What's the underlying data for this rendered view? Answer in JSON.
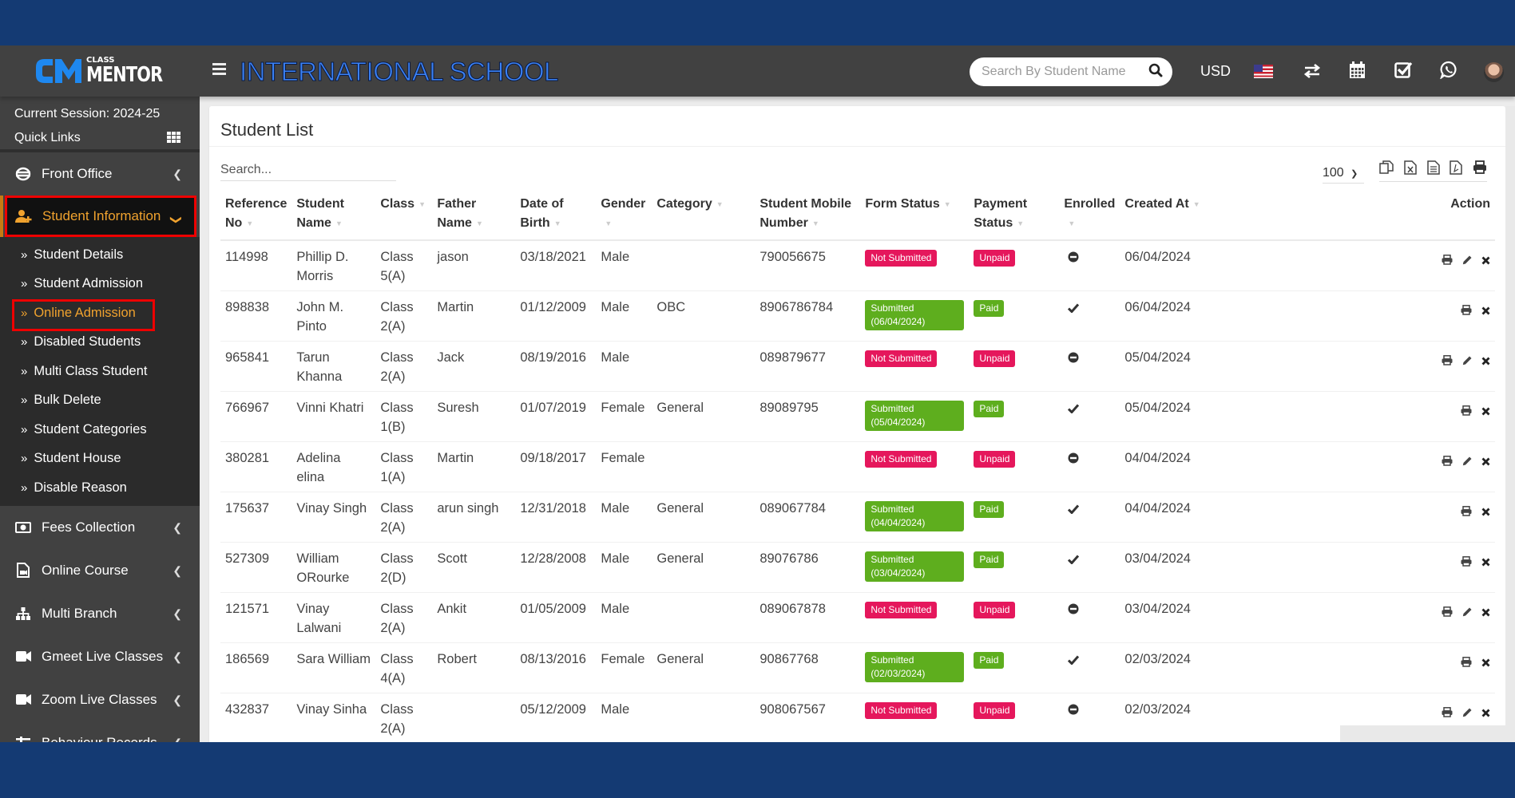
{
  "header": {
    "logo_small": "CLASS",
    "logo_big": "MENTOR",
    "school_name": "INTERNATIONAL SCHOOL",
    "search_placeholder": "Search By Student Name",
    "currency": "USD",
    "icons": [
      "us-flag-icon",
      "switch-arrows-icon",
      "calendar-icon",
      "checkbox-icon",
      "whatsapp-icon",
      "user-avatar"
    ]
  },
  "sidebar": {
    "session": "Current Session: 2024-25",
    "quick_links": "Quick Links",
    "items": [
      {
        "label": "Front Office",
        "icon": "front-office-icon",
        "active": false
      },
      {
        "label": "Student Information",
        "icon": "user-plus-icon",
        "active": true
      },
      {
        "label": "Fees Collection",
        "icon": "money-icon",
        "active": false
      },
      {
        "label": "Online Course",
        "icon": "file-video-icon",
        "active": false
      },
      {
        "label": "Multi Branch",
        "icon": "sitemap-icon",
        "active": false
      },
      {
        "label": "Gmeet Live Classes",
        "icon": "video-camera-icon",
        "active": false
      },
      {
        "label": "Zoom Live Classes",
        "icon": "video-camera-icon",
        "active": false
      },
      {
        "label": "Behaviour Records",
        "icon": "sliders-icon",
        "active": false
      }
    ],
    "submenu": [
      {
        "label": "Student Details",
        "active": false
      },
      {
        "label": "Student Admission",
        "active": false
      },
      {
        "label": "Online Admission",
        "active": true
      },
      {
        "label": "Disabled Students",
        "active": false
      },
      {
        "label": "Multi Class Student",
        "active": false
      },
      {
        "label": "Bulk Delete",
        "active": false
      },
      {
        "label": "Student Categories",
        "active": false
      },
      {
        "label": "Student House",
        "active": false
      },
      {
        "label": "Disable Reason",
        "active": false
      }
    ]
  },
  "main": {
    "title": "Student List",
    "search_placeholder": "Search...",
    "page_length": "100",
    "export_buttons": [
      "copy-icon",
      "excel-icon",
      "csv-icon",
      "pdf-icon",
      "print-icon"
    ],
    "columns": [
      {
        "label": "Reference No",
        "sortable": true
      },
      {
        "label": "Student Name",
        "sortable": true
      },
      {
        "label": "Class",
        "sortable": true
      },
      {
        "label": "Father Name",
        "sortable": true
      },
      {
        "label": "Date of Birth",
        "sortable": true
      },
      {
        "label": "Gender",
        "sortable": true
      },
      {
        "label": "Category",
        "sortable": true
      },
      {
        "label": "Student Mobile Number",
        "sortable": true
      },
      {
        "label": "Form Status",
        "sortable": true
      },
      {
        "label": "Payment Status",
        "sortable": true
      },
      {
        "label": "Enrolled",
        "sortable": true
      },
      {
        "label": "Created At",
        "sortable": true
      },
      {
        "label": "Action",
        "sortable": false
      }
    ],
    "rows": [
      {
        "ref": "114998",
        "name": "Phillip D. Morris",
        "class": "Class 5(A)",
        "father": "jason",
        "dob": "03/18/2021",
        "gender": "Male",
        "category": "",
        "mobile": "790056675",
        "form_status": "Not Submitted",
        "form_ok": false,
        "payment": "Unpaid",
        "paid": false,
        "enrolled": false,
        "created": "06/04/2024"
      },
      {
        "ref": "898838",
        "name": "John M. Pinto",
        "class": "Class 2(A)",
        "father": "Martin",
        "dob": "01/12/2009",
        "gender": "Male",
        "category": "OBC",
        "mobile": "8906786784",
        "form_status": "Submitted (06/04/2024)",
        "form_ok": true,
        "payment": "Paid",
        "paid": true,
        "enrolled": true,
        "created": "06/04/2024"
      },
      {
        "ref": "965841",
        "name": "Tarun Khanna",
        "class": "Class 2(A)",
        "father": "Jack",
        "dob": "08/19/2016",
        "gender": "Male",
        "category": "",
        "mobile": "089879677",
        "form_status": "Not Submitted",
        "form_ok": false,
        "payment": "Unpaid",
        "paid": false,
        "enrolled": false,
        "created": "05/04/2024"
      },
      {
        "ref": "766967",
        "name": "Vinni Khatri",
        "class": "Class 1(B)",
        "father": "Suresh",
        "dob": "01/07/2019",
        "gender": "Female",
        "category": "General",
        "mobile": "89089795",
        "form_status": "Submitted (05/04/2024)",
        "form_ok": true,
        "payment": "Paid",
        "paid": true,
        "enrolled": true,
        "created": "05/04/2024"
      },
      {
        "ref": "380281",
        "name": "Adelina elina",
        "class": "Class 1(A)",
        "father": "Martin",
        "dob": "09/18/2017",
        "gender": "Female",
        "category": "",
        "mobile": "",
        "form_status": "Not Submitted",
        "form_ok": false,
        "payment": "Unpaid",
        "paid": false,
        "enrolled": false,
        "created": "04/04/2024"
      },
      {
        "ref": "175637",
        "name": "Vinay Singh",
        "class": "Class 2(A)",
        "father": "arun singh",
        "dob": "12/31/2018",
        "gender": "Male",
        "category": "General",
        "mobile": "089067784",
        "form_status": "Submitted (04/04/2024)",
        "form_ok": true,
        "payment": "Paid",
        "paid": true,
        "enrolled": true,
        "created": "04/04/2024"
      },
      {
        "ref": "527309",
        "name": "William ORourke",
        "class": "Class 2(D)",
        "father": "Scott",
        "dob": "12/28/2008",
        "gender": "Male",
        "category": "General",
        "mobile": "89076786",
        "form_status": "Submitted (03/04/2024)",
        "form_ok": true,
        "payment": "Paid",
        "paid": true,
        "enrolled": true,
        "created": "03/04/2024"
      },
      {
        "ref": "121571",
        "name": "Vinay Lalwani",
        "class": "Class 2(A)",
        "father": "Ankit",
        "dob": "01/05/2009",
        "gender": "Male",
        "category": "",
        "mobile": "089067878",
        "form_status": "Not Submitted",
        "form_ok": false,
        "payment": "Unpaid",
        "paid": false,
        "enrolled": false,
        "created": "03/04/2024"
      },
      {
        "ref": "186569",
        "name": "Sara William",
        "class": "Class 4(A)",
        "father": "Robert",
        "dob": "08/13/2016",
        "gender": "Female",
        "category": "General",
        "mobile": "90867768",
        "form_status": "Submitted (02/03/2024)",
        "form_ok": true,
        "payment": "Paid",
        "paid": true,
        "enrolled": true,
        "created": "02/03/2024"
      },
      {
        "ref": "432837",
        "name": "Vinay Sinha",
        "class": "Class 2(A)",
        "father": "",
        "dob": "05/12/2009",
        "gender": "Male",
        "category": "",
        "mobile": "908067567",
        "form_status": "Not Submitted",
        "form_ok": false,
        "payment": "Unpaid",
        "paid": false,
        "enrolled": false,
        "created": "02/03/2024"
      }
    ]
  },
  "colors": {
    "brand_blue": "#3b82f6",
    "frame_blue": "#143a73",
    "active_orange": "#f0a22e",
    "highlight_red": "#ee0000",
    "badge_red": "#e5175c",
    "badge_green": "#5eae1e"
  }
}
